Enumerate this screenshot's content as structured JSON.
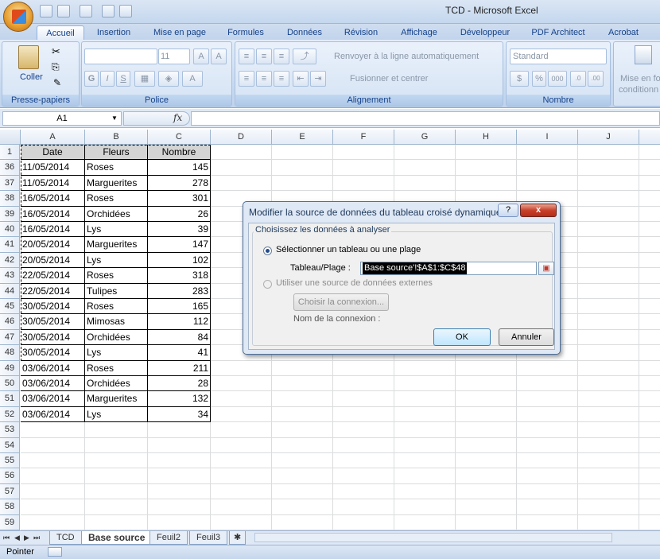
{
  "window": {
    "title": "TCD - Microsoft Excel"
  },
  "tabs": [
    "Accueil",
    "Insertion",
    "Mise en page",
    "Formules",
    "Données",
    "Révision",
    "Affichage",
    "Développeur",
    "PDF Architect",
    "Acrobat"
  ],
  "ribbon": {
    "clipboard": {
      "label": "Presse-papiers",
      "paste": "Coller"
    },
    "font": {
      "label": "Police",
      "size": "11",
      "bold": "G",
      "italic": "I",
      "underline": "S"
    },
    "alignment": {
      "label": "Alignement",
      "wrap": "Renvoyer à la ligne automatiquement",
      "merge": "Fusionner et centrer"
    },
    "number": {
      "label": "Nombre",
      "format": "Standard",
      "currency": "$",
      "percent": "%",
      "thousands": "000"
    },
    "styles": {
      "cond_format": "Mise en fo",
      "cond_format2": "conditionn"
    }
  },
  "formula_bar": {
    "name_box": "A1",
    "fx": "fx",
    "formula": ""
  },
  "columns": [
    "A",
    "B",
    "C",
    "D",
    "E",
    "F",
    "G",
    "H",
    "I",
    "J"
  ],
  "rows": {
    "header_row": "1",
    "header": [
      "Date",
      "Fleurs",
      "Nombre"
    ],
    "data": [
      [
        "36",
        "11/05/2014",
        "Roses",
        "145"
      ],
      [
        "37",
        "11/05/2014",
        "Marguerites",
        "278"
      ],
      [
        "38",
        "16/05/2014",
        "Roses",
        "301"
      ],
      [
        "39",
        "16/05/2014",
        "Orchidées",
        "26"
      ],
      [
        "40",
        "16/05/2014",
        "Lys",
        "39"
      ],
      [
        "41",
        "20/05/2014",
        "Marguerites",
        "147"
      ],
      [
        "42",
        "20/05/2014",
        "Lys",
        "102"
      ],
      [
        "43",
        "22/05/2014",
        "Roses",
        "318"
      ],
      [
        "44",
        "22/05/2014",
        "Tulipes",
        "283"
      ],
      [
        "45",
        "30/05/2014",
        "Roses",
        "165"
      ],
      [
        "46",
        "30/05/2014",
        "Mimosas",
        "112"
      ],
      [
        "47",
        "30/05/2014",
        "Orchidées",
        "84"
      ],
      [
        "48",
        "30/05/2014",
        "Lys",
        "41"
      ],
      [
        "49",
        "03/06/2014",
        "Roses",
        "211"
      ],
      [
        "50",
        "03/06/2014",
        "Orchidées",
        "28"
      ],
      [
        "51",
        "03/06/2014",
        "Marguerites",
        "132"
      ],
      [
        "52",
        "03/06/2014",
        "Lys",
        "34"
      ],
      [
        "53",
        "",
        "",
        ""
      ],
      [
        "54",
        "",
        "",
        ""
      ],
      [
        "55",
        "",
        "",
        ""
      ],
      [
        "56",
        "",
        "",
        ""
      ],
      [
        "57",
        "",
        "",
        ""
      ],
      [
        "58",
        "",
        "",
        ""
      ],
      [
        "59",
        "",
        "",
        ""
      ]
    ]
  },
  "dialog": {
    "title": "Modifier la source de données du tableau croisé dynamique",
    "help": "?",
    "close": "x",
    "group_label": "Choisissez les données à analyser",
    "option1": "Sélectionner un tableau ou une plage",
    "range_label": "Tableau/Plage :",
    "range_value": "Base source'!$A$1:$C$48",
    "option2": "Utiliser une source de données externes",
    "choose_conn": "Choisir la connexion...",
    "conn_name_label": "Nom de la connexion :",
    "ok": "OK",
    "cancel": "Annuler"
  },
  "sheets": [
    "TCD",
    "Base source",
    "Feuil2",
    "Feuil3"
  ],
  "status": {
    "mode": "Pointer"
  }
}
